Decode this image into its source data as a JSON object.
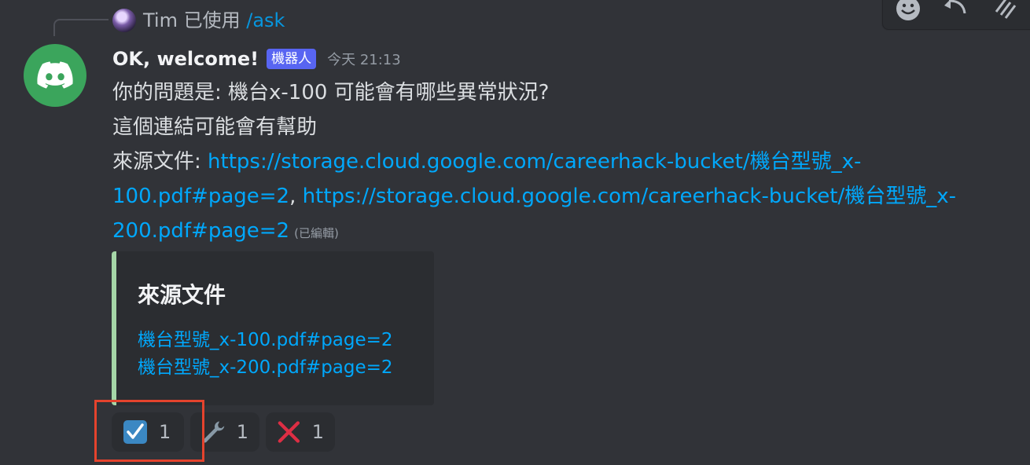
{
  "reply": {
    "user": "Tim",
    "used_text": "已使用",
    "command": "/ask"
  },
  "message": {
    "username": "OK, welcome!",
    "bot_tag": "機器人",
    "timestamp": "今天 21:13",
    "line1": "你的問題是: 機台x-100 可能會有哪些異常狀況?",
    "line2": "這個連結可能會有幫助",
    "source_label": "來源文件: ",
    "link1_part1": "https://storage.cloud.google.com/careerhack-bucket/機台型號_x-",
    "link1_part2": "100.pdf#page=2",
    "separator": ", ",
    "link2_part1": "https://storage.cloud.google.com/careerhack-bucket/機台型號_x-",
    "link2_part2": "200.pdf#page=2",
    "edited": "(已編輯)"
  },
  "embed": {
    "title": "來源文件",
    "links": [
      "機台型號_x-100.pdf#page=2",
      "機台型號_x-200.pdf#page=2"
    ],
    "accent_color": "#a5d6a7"
  },
  "reactions": [
    {
      "emoji": "check-box",
      "count": "1"
    },
    {
      "emoji": "wrench",
      "count": "1"
    },
    {
      "emoji": "cross-mark",
      "count": "1"
    }
  ],
  "toolbar": {
    "icons": [
      "add-reaction-icon",
      "reply-icon",
      "more-icon"
    ]
  },
  "colors": {
    "background": "#313338",
    "link": "#00a8fc",
    "bot_tag": "#5865f2",
    "avatar": "#3ba55c",
    "highlight": "#e5432d"
  }
}
